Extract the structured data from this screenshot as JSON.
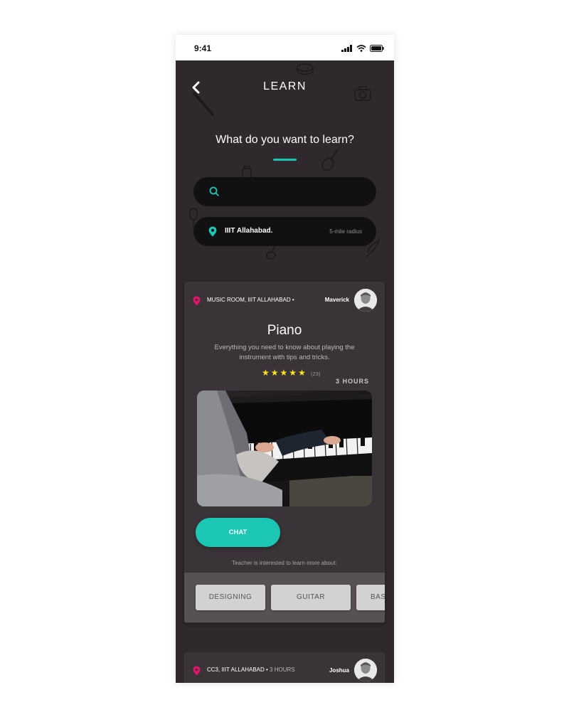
{
  "status_bar": {
    "time": "9:41"
  },
  "header": {
    "title": "LEARN"
  },
  "prompt": {
    "question": "What do you want to learn?"
  },
  "search": {
    "placeholder": "",
    "value": ""
  },
  "location": {
    "name": "IIIT Allahabad.",
    "radius": "5-mile radius"
  },
  "cards": [
    {
      "location": "MUSIC ROOM, IIIT ALLAHABAD •",
      "teacher": "Maverick",
      "title": "Piano",
      "description": "Everything you need to know about playing the instrument with tips and tricks.",
      "rating": 5,
      "stars": [
        "★",
        "★",
        "★",
        "★",
        "★"
      ],
      "reviews": "(23)",
      "duration": "3 HOURS",
      "chat_label": "CHAT",
      "interest_label": "Teacher is interested to learn more about:",
      "interests": [
        "DESIGNING",
        "GUITAR",
        "BASS"
      ]
    },
    {
      "location": "CC3, IIIT ALLAHABAD •",
      "duration": "3 HOURS",
      "teacher": "Joshua"
    }
  ],
  "colors": {
    "background": "#2f292d",
    "card": "#3a3438",
    "accent": "#1bc6b4",
    "pin": "#e8106a",
    "star": "#f7e51e"
  }
}
